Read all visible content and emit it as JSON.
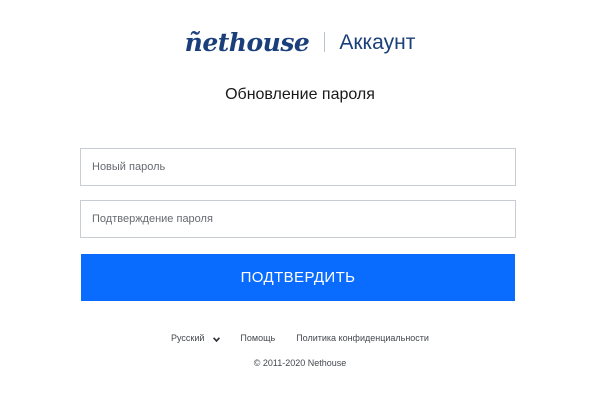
{
  "brand": {
    "logo_text": "ñethouse",
    "section_label": "Аккаунт",
    "color": "#1b3f7a"
  },
  "page": {
    "title": "Обновление пароля"
  },
  "form": {
    "new_password_placeholder": "Новый пароль",
    "confirm_password_placeholder": "Подтверждение пароля",
    "submit_label": "ПОДТВЕРДИТЬ",
    "submit_color": "#0a6cff"
  },
  "footer": {
    "language": "Русский",
    "language_icon": "chevron-down-icon",
    "help_label": "Помощь",
    "privacy_label": "Политика конфиденциальности",
    "copyright": "© 2011-2020 Nethouse"
  }
}
